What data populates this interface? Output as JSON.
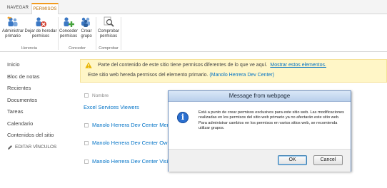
{
  "ribbon": {
    "tabs": {
      "navegar": "NAVEGAR",
      "permisos": "PERMISOS"
    },
    "buttons": {
      "administrar_primario": [
        "Administrar",
        "primario"
      ],
      "dejar_de_heredar": [
        "Dejar de heredar",
        "permisos"
      ],
      "conceder_permisos": [
        "Conceder",
        "permisos"
      ],
      "crear_grupo": [
        "Crear",
        "grupo"
      ],
      "comprobar_permisos": [
        "Comprobar",
        "permisos"
      ]
    },
    "groups": {
      "herencia": "Herencia",
      "conceder": "Conceder",
      "comprobar": "Comprobar"
    },
    "colors": {
      "accent": "#f29b1d",
      "icon_blue": "#3b78c4",
      "icon_red": "#d33c2c",
      "icon_green": "#45a23c"
    }
  },
  "leftnav": {
    "items": [
      "Inicio",
      "Bloc de notas",
      "Recientes",
      "Documentos",
      "Tareas",
      "Calendario",
      "Contenidos del sitio"
    ],
    "edit_links": "EDITAR VÍNCULOS"
  },
  "warning": {
    "line1": "Parte del contenido de este sitio tiene permisos diferentes de lo que ve aquí.",
    "link1": "Mostrar estos elementos.",
    "line2": "Este sitio web hereda permisos del elemento primario.",
    "link2": "(Manolo Herrera Dev Center)"
  },
  "list": {
    "header": "Nombre",
    "rows": [
      "Excel Services Viewers",
      "Manolo Herrera Dev Center Memb",
      "Manolo Herrera Dev Center Owner",
      "Manolo Herrera Dev Center Visitor"
    ]
  },
  "dialog": {
    "title": "Message from webpage",
    "message": "Está a punto de crear permisos exclusivos para este sitio web. Las modificaciones realizadas en los permisos del sitio web primario ya no afectarán este sitio web. Para administrar cambios en los permisos en varios sitios web, se recomienda utilizar grupos.",
    "ok": "OK",
    "cancel": "Cancel",
    "icon": "info-icon"
  }
}
